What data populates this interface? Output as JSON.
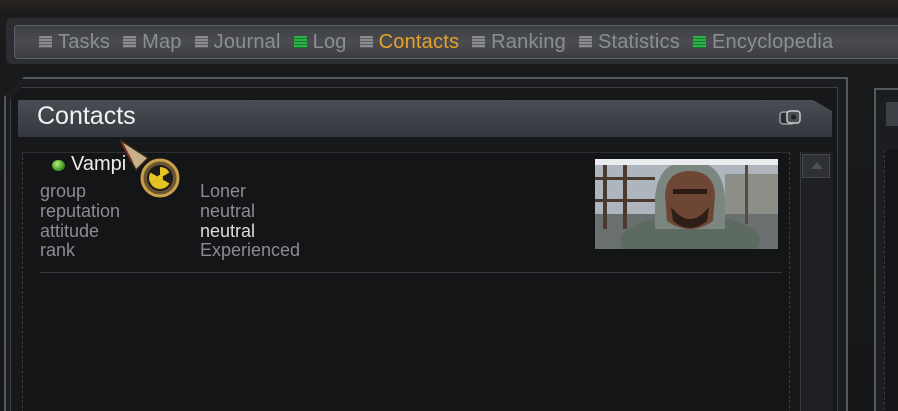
{
  "tabs": [
    {
      "label": "Tasks",
      "icon": "document-icon",
      "active": false,
      "new": false
    },
    {
      "label": "Map",
      "icon": "document-icon",
      "active": false,
      "new": false
    },
    {
      "label": "Journal",
      "icon": "document-icon",
      "active": false,
      "new": false
    },
    {
      "label": "Log",
      "icon": "document-icon",
      "active": false,
      "new": true
    },
    {
      "label": "Contacts",
      "icon": "document-icon",
      "active": true,
      "new": false
    },
    {
      "label": "Ranking",
      "icon": "document-icon",
      "active": false,
      "new": false
    },
    {
      "label": "Statistics",
      "icon": "document-icon",
      "active": false,
      "new": false
    },
    {
      "label": "Encyclopedia",
      "icon": "document-icon",
      "active": false,
      "new": true
    }
  ],
  "panel": {
    "title": "Contacts",
    "title_icon": "gear-icon"
  },
  "contact": {
    "name": "Vampi",
    "status_icon": "online-dot-icon",
    "attributes": [
      {
        "label": "group",
        "value": "Loner"
      },
      {
        "label": "reputation",
        "value": "neutral"
      },
      {
        "label": "attitude",
        "value": "neutral"
      },
      {
        "label": "rank",
        "value": "Experienced"
      }
    ]
  },
  "colors": {
    "active_tab": "#e8a226",
    "inactive_tab": "#8b8e93",
    "new_indicator": "#2fb04a"
  }
}
